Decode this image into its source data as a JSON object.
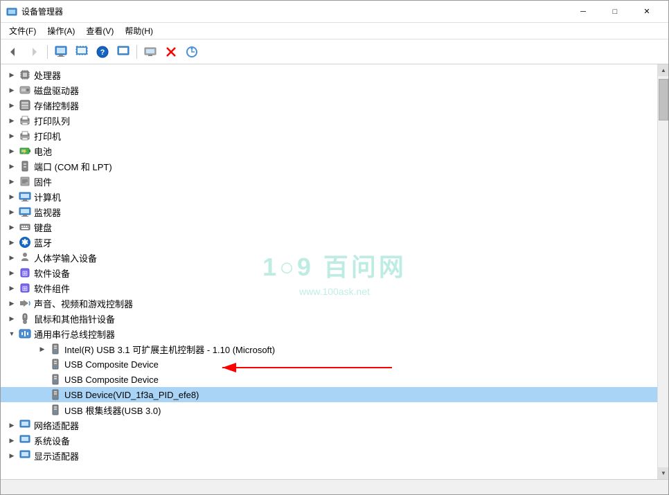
{
  "window": {
    "title": "设备管理器",
    "min_label": "─",
    "max_label": "□",
    "close_label": "✕"
  },
  "menu": {
    "items": [
      {
        "label": "文件(F)"
      },
      {
        "label": "操作(A)"
      },
      {
        "label": "查看(V)"
      },
      {
        "label": "帮助(H)"
      }
    ]
  },
  "tree": {
    "items": [
      {
        "id": "processor",
        "label": "处理器",
        "icon": "⚙",
        "indent": 0,
        "expanded": false
      },
      {
        "id": "disk",
        "label": "磁盘驱动器",
        "icon": "💾",
        "indent": 0,
        "expanded": false
      },
      {
        "id": "storage",
        "label": "存储控制器",
        "icon": "🗄",
        "indent": 0,
        "expanded": false
      },
      {
        "id": "printqueue",
        "label": "打印队列",
        "icon": "🖨",
        "indent": 0,
        "expanded": false
      },
      {
        "id": "printer",
        "label": "打印机",
        "icon": "🖨",
        "indent": 0,
        "expanded": false
      },
      {
        "id": "battery",
        "label": "电池",
        "icon": "🔋",
        "indent": 0,
        "expanded": false
      },
      {
        "id": "port",
        "label": "端口 (COM 和 LPT)",
        "icon": "🔌",
        "indent": 0,
        "expanded": false
      },
      {
        "id": "firmware",
        "label": "固件",
        "icon": "📋",
        "indent": 0,
        "expanded": false
      },
      {
        "id": "computer",
        "label": "计算机",
        "icon": "🖥",
        "indent": 0,
        "expanded": false
      },
      {
        "id": "monitor",
        "label": "监视器",
        "icon": "🖥",
        "indent": 0,
        "expanded": false
      },
      {
        "id": "keyboard",
        "label": "键盘",
        "icon": "⌨",
        "indent": 0,
        "expanded": false
      },
      {
        "id": "bluetooth",
        "label": "蓝牙",
        "icon": "✱",
        "indent": 0,
        "expanded": false
      },
      {
        "id": "hid",
        "label": "人体学输入设备",
        "icon": "👤",
        "indent": 0,
        "expanded": false
      },
      {
        "id": "software",
        "label": "软件设备",
        "icon": "📦",
        "indent": 0,
        "expanded": false
      },
      {
        "id": "softcomp",
        "label": "软件组件",
        "icon": "📦",
        "indent": 0,
        "expanded": false
      },
      {
        "id": "sound",
        "label": "声音、视频和游戏控制器",
        "icon": "🔊",
        "indent": 0,
        "expanded": false
      },
      {
        "id": "mouse",
        "label": "鼠标和其他指针设备",
        "icon": "🖱",
        "indent": 0,
        "expanded": false
      },
      {
        "id": "usb",
        "label": "通用串行总线控制器",
        "icon": "⬢",
        "indent": 0,
        "expanded": true
      },
      {
        "id": "usb-intel",
        "label": "Intel(R) USB 3.1 可扩展主机控制器 - 1.10 (Microsoft)",
        "icon": "🔌",
        "indent": 1,
        "expanded": false
      },
      {
        "id": "usb-comp1",
        "label": "USB Composite Device",
        "icon": "🔌",
        "indent": 1,
        "expanded": false
      },
      {
        "id": "usb-comp2",
        "label": "USB Composite Device",
        "icon": "🔌",
        "indent": 1,
        "expanded": false
      },
      {
        "id": "usb-device",
        "label": "USB Device(VID_1f3a_PID_efe8)",
        "icon": "🔌",
        "indent": 1,
        "expanded": false,
        "selected": true
      },
      {
        "id": "usb-hub",
        "label": "USB 根集线器(USB 3.0)",
        "icon": "🔌",
        "indent": 1,
        "expanded": false
      },
      {
        "id": "network",
        "label": "网络适配器",
        "icon": "📁",
        "indent": 0,
        "expanded": false
      },
      {
        "id": "sysdev",
        "label": "系统设备",
        "icon": "📁",
        "indent": 0,
        "expanded": false
      },
      {
        "id": "display",
        "label": "显示适配器",
        "icon": "📁",
        "indent": 0,
        "expanded": false
      }
    ]
  },
  "watermark": {
    "line1": "1○9 百问网",
    "line2": "www.100ask.net"
  },
  "status_bar": {
    "text": ""
  },
  "toolbar": {
    "buttons": [
      {
        "name": "back",
        "icon": "←"
      },
      {
        "name": "forward",
        "icon": "→"
      },
      {
        "name": "devmgr",
        "icon": "⊞"
      },
      {
        "name": "devmgr2",
        "icon": "⊟"
      },
      {
        "name": "help",
        "icon": "?"
      },
      {
        "name": "view",
        "icon": "⊞"
      },
      {
        "name": "computer",
        "icon": "💻"
      },
      {
        "name": "delete",
        "icon": "✕",
        "color": "red"
      },
      {
        "name": "update",
        "icon": "⊕"
      }
    ]
  }
}
